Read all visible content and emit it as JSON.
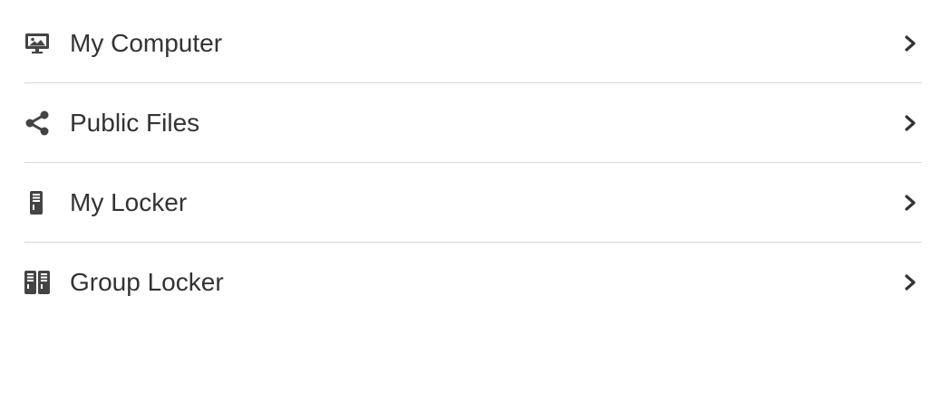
{
  "nav": {
    "items": [
      {
        "label": "My Computer",
        "icon": "monitor-image-icon"
      },
      {
        "label": "Public Files",
        "icon": "share-icon"
      },
      {
        "label": "My Locker",
        "icon": "locker-icon"
      },
      {
        "label": "Group Locker",
        "icon": "group-locker-icon"
      }
    ]
  },
  "colors": {
    "text": "#333333",
    "icon": "#444444",
    "divider": "#d9d9d9"
  }
}
